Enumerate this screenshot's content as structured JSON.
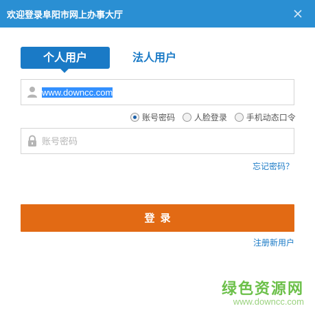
{
  "window": {
    "title": "欢迎登录阜阳市网上办事大厅",
    "close_icon": "close-icon"
  },
  "tabs": [
    {
      "label": "个人用户",
      "active": true
    },
    {
      "label": "法人用户",
      "active": false
    }
  ],
  "username": {
    "value": "www.downcc.com",
    "icon": "user-icon"
  },
  "login_methods": [
    {
      "label": "账号密码",
      "checked": true
    },
    {
      "label": "人脸登录",
      "checked": false
    },
    {
      "label": "手机动态口令",
      "checked": false
    }
  ],
  "password": {
    "placeholder": "账号密码",
    "icon": "lock-icon"
  },
  "forgot_password": "忘记密码？",
  "login_button": "登录",
  "register_link": "注册新用户",
  "watermark": {
    "logo_text": "绿色资源网",
    "url": "www.downcc.com"
  },
  "colors": {
    "titlebar": "#2a8fd3",
    "tab_active": "#1a7ac6",
    "login_button": "#e26a14",
    "link": "#1a7ac6",
    "watermark": "#6cc04a"
  }
}
